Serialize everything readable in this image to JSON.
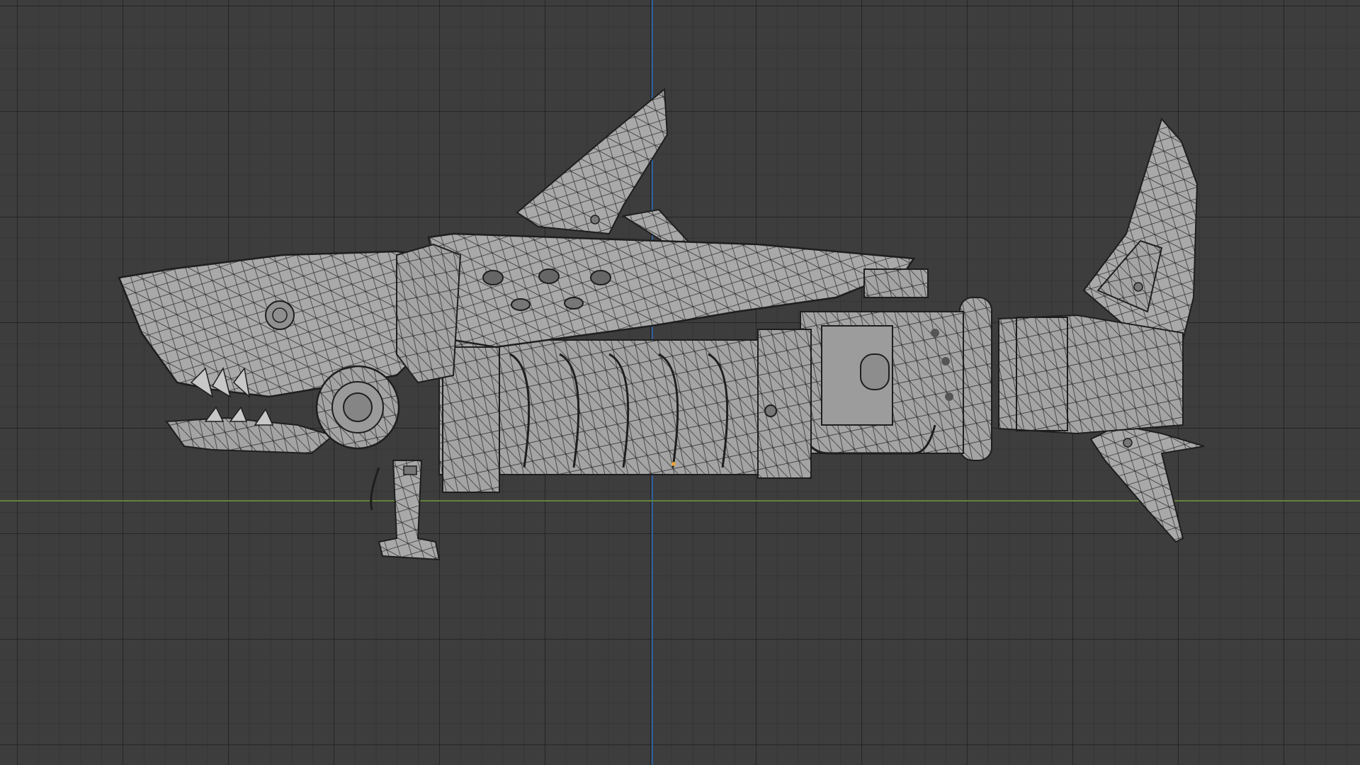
{
  "viewport": {
    "background_color": "#3d3d3d",
    "grid_color": "#2e2e2e",
    "x_axis_color": "#62823a",
    "y_axis_color": "#2f5f9a",
    "mesh_fill_color": "#a8a8a8",
    "wire_color": "#1e1e1e",
    "origin_color": "#e8a23a"
  }
}
